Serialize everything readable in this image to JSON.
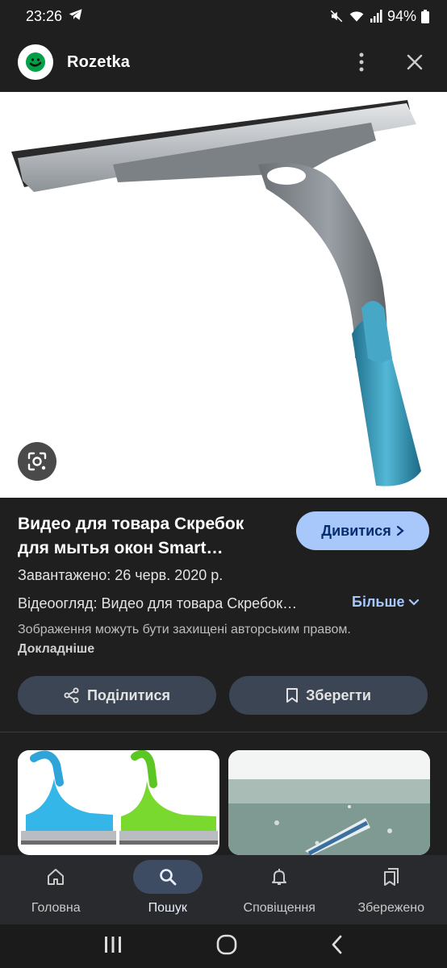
{
  "status_bar": {
    "time": "23:26",
    "battery": "94%"
  },
  "header": {
    "site_name": "Rozetka"
  },
  "result": {
    "title": "Видео для товара Скребок для мытья окон Smart…",
    "view_button": "Дивитися",
    "uploaded": "Завантажено: 26 черв. 2020 р.",
    "description": "Відеоогляд: Видео для товара Скребок…",
    "more_button": "Більше",
    "copyright_text": "Зображення можуть бути захищені авторським правом.",
    "copyright_link": "Докладніше",
    "share_button": "Поділитися",
    "save_button": "Зберегти"
  },
  "bottom_nav": [
    {
      "label": "Головна",
      "icon": "home-icon",
      "active": false
    },
    {
      "label": "Пошук",
      "icon": "search-icon",
      "active": true
    },
    {
      "label": "Сповіщення",
      "icon": "bell-icon",
      "active": false
    },
    {
      "label": "Збережено",
      "icon": "bookmarks-icon",
      "active": false
    }
  ],
  "colors": {
    "accent": "#a8c7fa",
    "accent_text": "#062e6f",
    "pill_bg": "#3c4554",
    "nav_bg": "#292a2d"
  }
}
